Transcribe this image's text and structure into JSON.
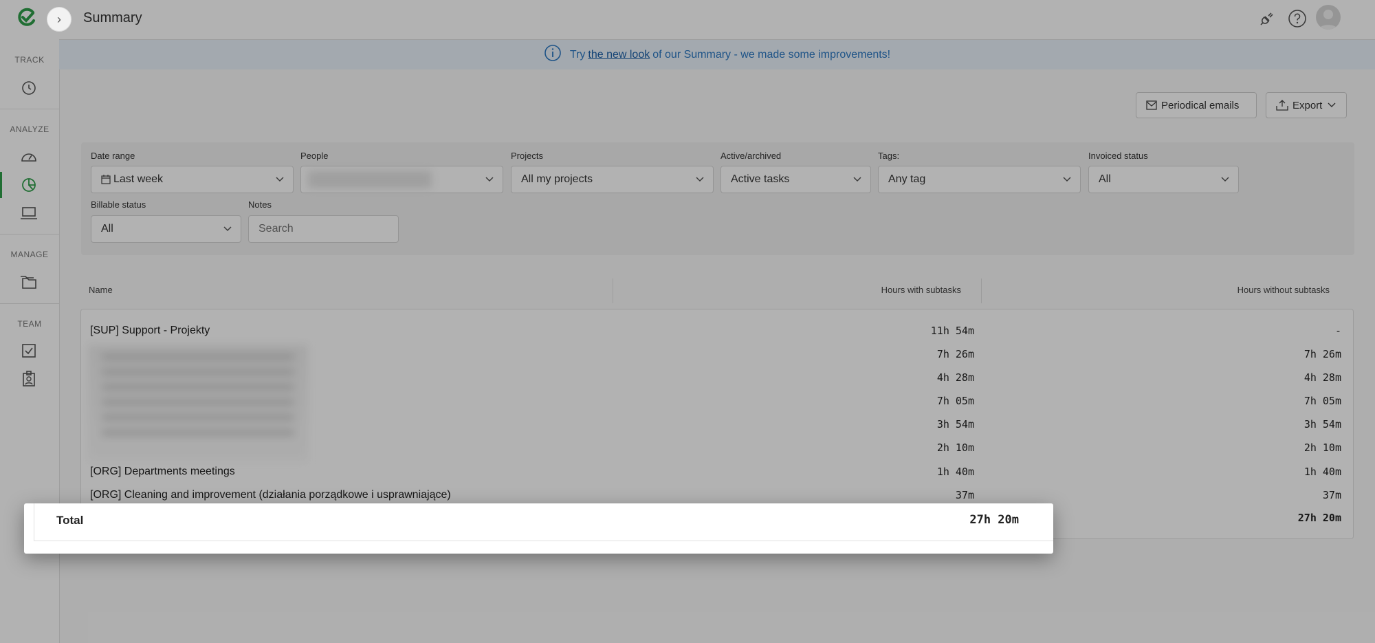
{
  "header": {
    "title": "Summary"
  },
  "sidebar": {
    "sections": [
      {
        "label": "TRACK",
        "items": [
          {
            "icon": "clock-icon"
          }
        ]
      },
      {
        "label": "ANALYZE",
        "items": [
          {
            "icon": "dashboard-icon"
          },
          {
            "icon": "pie-chart-icon",
            "active": true
          },
          {
            "icon": "laptop-icon"
          }
        ]
      },
      {
        "label": "MANAGE",
        "items": [
          {
            "icon": "folder-icon"
          }
        ]
      },
      {
        "label": "TEAM",
        "items": [
          {
            "icon": "checkbox-icon"
          },
          {
            "icon": "badge-icon"
          }
        ]
      }
    ]
  },
  "banner": {
    "prefix": "Try",
    "link": "the new look",
    "suffix": "of our Summary - we made some improvements!"
  },
  "toolbar": {
    "periodical_emails": "Periodical emails",
    "export": "Export"
  },
  "filters": {
    "date_range": {
      "label": "Date range",
      "value": "Last week"
    },
    "people": {
      "label": "People",
      "value": ""
    },
    "projects": {
      "label": "Projects",
      "value": "All my projects"
    },
    "active_archived": {
      "label": "Active/archived",
      "value": "Active tasks"
    },
    "tags": {
      "label": "Tags:",
      "value": "Any tag"
    },
    "invoiced_status": {
      "label": "Invoiced status",
      "value": "All"
    },
    "billable_status": {
      "label": "Billable status",
      "value": "All"
    },
    "notes": {
      "label": "Notes",
      "placeholder": "Search"
    }
  },
  "table": {
    "columns": {
      "name": "Name",
      "with_subtasks": "Hours with subtasks",
      "without_subtasks": "Hours without subtasks"
    },
    "rows": [
      {
        "name": "[SUP] Support - Projekty",
        "with": "11h 54m",
        "without": "-"
      },
      {
        "name": "",
        "with": "7h 26m",
        "without": "7h 26m"
      },
      {
        "name": "",
        "with": "4h 28m",
        "without": "4h 28m"
      },
      {
        "name": "",
        "with": "7h 05m",
        "without": "7h 05m"
      },
      {
        "name": "",
        "with": "3h 54m",
        "without": "3h 54m"
      },
      {
        "name": "",
        "with": "2h 10m",
        "without": "2h 10m"
      },
      {
        "name": "[ORG] Departments meetings",
        "with": "1h 40m",
        "without": "1h 40m"
      },
      {
        "name": "[ORG] Cleaning and improvement (działania porządkowe i usprawniające)",
        "with": "37m",
        "without": "37m"
      }
    ],
    "total": {
      "label": "Total",
      "with": "27h 20m",
      "without": "27h 20m"
    }
  },
  "colors": {
    "brand": "#2e9e4a",
    "link": "#2b78c2"
  }
}
